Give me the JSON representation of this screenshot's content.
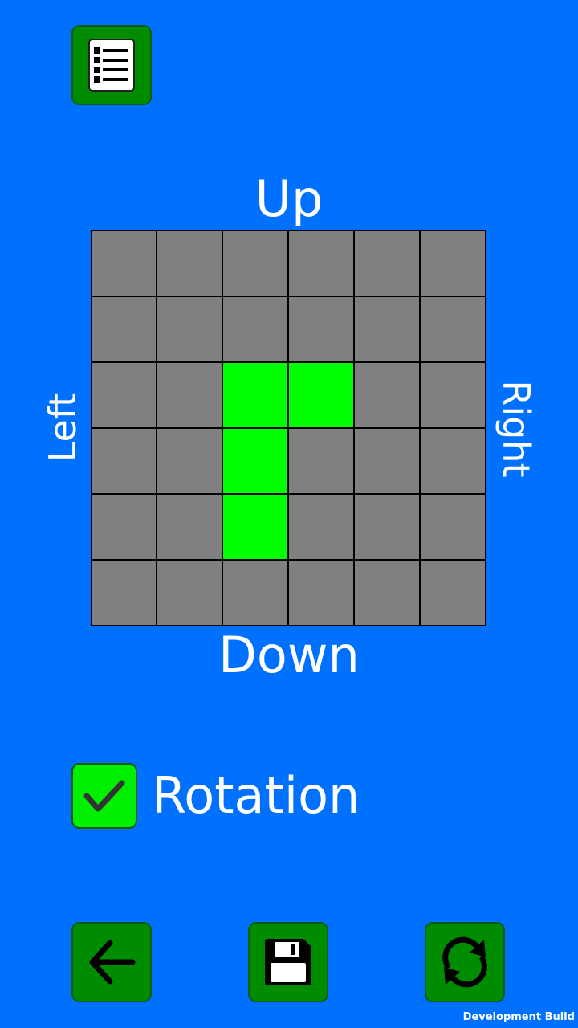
{
  "colors": {
    "background": "#0070ff",
    "button": "#008c00",
    "cell_off": "#808080",
    "cell_on": "#00ff00",
    "checkbox": "#00ee00"
  },
  "toolbar": {
    "menu_icon": "list-icon"
  },
  "directions": {
    "up": "Up",
    "down": "Down",
    "left": "Left",
    "right": "Right"
  },
  "grid": {
    "rows": 6,
    "cols": 6,
    "cells": [
      [
        0,
        0,
        0,
        0,
        0,
        0
      ],
      [
        0,
        0,
        0,
        0,
        0,
        0
      ],
      [
        0,
        0,
        1,
        1,
        0,
        0
      ],
      [
        0,
        0,
        1,
        0,
        0,
        0
      ],
      [
        0,
        0,
        1,
        0,
        0,
        0
      ],
      [
        0,
        0,
        0,
        0,
        0,
        0
      ]
    ]
  },
  "rotation": {
    "label": "Rotation",
    "checked": true
  },
  "bottom_bar": {
    "back_icon": "arrow-left-icon",
    "save_icon": "floppy-disk-icon",
    "refresh_icon": "refresh-icon"
  },
  "footer": {
    "build_label": "Development Build"
  }
}
